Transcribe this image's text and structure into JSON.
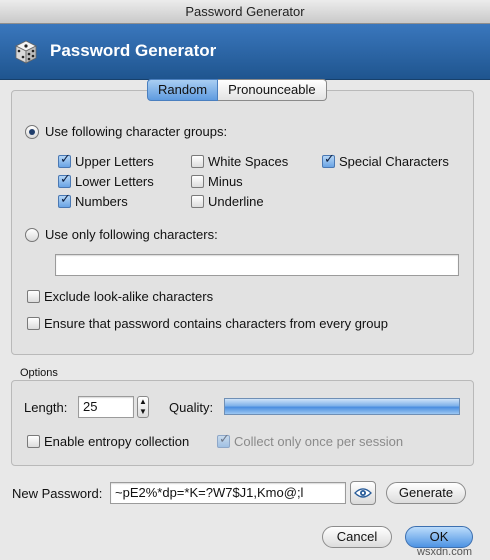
{
  "window": {
    "title": "Password Generator"
  },
  "header": {
    "title": "Password Generator",
    "icon": "dice-icon"
  },
  "tabs": [
    {
      "label": "Random",
      "active": true
    },
    {
      "label": "Pronounceable",
      "active": false
    }
  ],
  "random": {
    "radio_groups_label": "Use following character groups:",
    "groups": {
      "upper": {
        "label": "Upper Letters",
        "checked": true
      },
      "lower": {
        "label": "Lower Letters",
        "checked": true
      },
      "numbers": {
        "label": "Numbers",
        "checked": true
      },
      "white_spaces": {
        "label": "White Spaces",
        "checked": false
      },
      "minus": {
        "label": "Minus",
        "checked": false
      },
      "underline": {
        "label": "Underline",
        "checked": false
      },
      "special": {
        "label": "Special Characters",
        "checked": true
      }
    },
    "radio_only_label": "Use only following characters:",
    "only_chars_value": "",
    "exclude_lookalike_label": "Exclude look-alike characters",
    "ensure_every_group_label": "Ensure that password contains characters from every group"
  },
  "options": {
    "section_label": "Options",
    "length_label": "Length:",
    "length_value": "25",
    "quality_label": "Quality:",
    "entropy_label": "Enable entropy collection",
    "collect_once_label": "Collect only once per session"
  },
  "footer": {
    "new_password_label": "New Password:",
    "new_password_value": "~pE2%*dp=*K=?W7$J1,Kmo@;l",
    "generate_label": "Generate",
    "cancel_label": "Cancel",
    "ok_label": "OK"
  },
  "watermark": "wsxdn.com",
  "colors": {
    "header": "#2b66a8",
    "accent": "#4d93e3"
  }
}
